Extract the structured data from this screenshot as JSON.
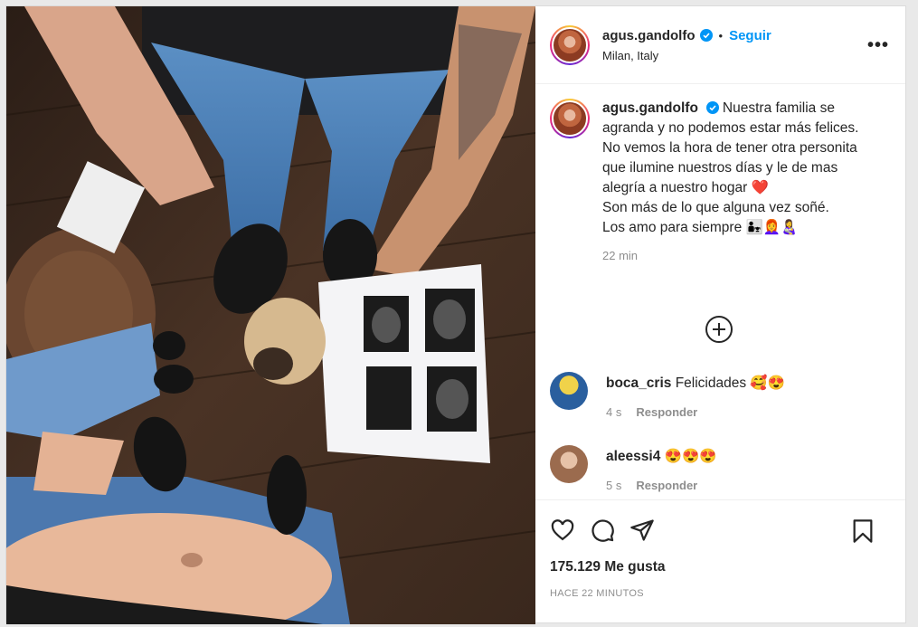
{
  "post": {
    "username": "agus.gandolfo",
    "separator": "•",
    "follow_label": "Seguir",
    "location": "Milan, Italy",
    "more_label": "•••",
    "caption_text": "Nuestra familia se agranda y no podemos estar más felices. No vemos la hora de tener otra personita que ilumine nuestros días y le de mas alegría a nuestro hogar",
    "caption_heart": "❤️",
    "caption_line2": "Son más de lo que alguna vez soñé.",
    "caption_line3": "Los amo para siempre 👨‍👧👩‍🦰👩‍🍼",
    "caption_time": "22 min"
  },
  "comments": [
    {
      "username": "boca_cris",
      "text": "Felicidades 🥰😍",
      "time": "4 s",
      "reply_label": "Responder",
      "avatar_color": "#d4c43a"
    },
    {
      "username": "aleessi4",
      "text": "😍😍😍",
      "time": "5 s",
      "reply_label": "Responder",
      "avatar_color": "#b88a6a"
    }
  ],
  "footer": {
    "likes": "175.129 Me gusta",
    "posted": "HACE 22 MINUTOS"
  },
  "icons": [
    "verified-icon",
    "more-icon",
    "add-comment-icon",
    "like-icon",
    "comment-icon",
    "share-icon",
    "save-icon"
  ],
  "colors": {
    "accent": "#0095f6",
    "text": "#262626",
    "muted": "#8e8e8e",
    "heart": "#e0112b"
  }
}
